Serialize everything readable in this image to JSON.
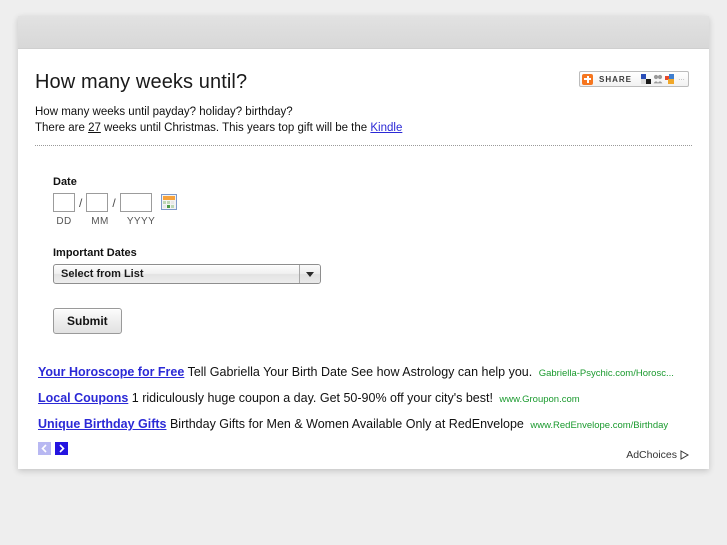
{
  "page": {
    "title": "How many weeks until?",
    "subtitle_line1": "How many weeks until payday? holiday? birthday?",
    "sentence_prefix": "There are ",
    "weeks_count": "27",
    "sentence_middle": " weeks until Christmas. This years top gift will be the ",
    "gift_link": "Kindle"
  },
  "share": {
    "label": "SHARE",
    "plus_icon": "addthis-plus-icon",
    "icon_1": "bookmark-icon",
    "icon_2": "facebook-icon",
    "icon_3": "more-services-icon",
    "dots": "…",
    "accent_color": "#f6761f"
  },
  "date_form": {
    "label": "Date",
    "day_value": "",
    "day_placeholder": "",
    "month_value": "",
    "month_placeholder": "",
    "year_value": "",
    "year_placeholder": "",
    "separator": "/",
    "hint_day": "DD",
    "hint_month": "MM",
    "hint_year": "YYYY",
    "calendar_icon": "calendar-picker-icon"
  },
  "important_dates": {
    "label": "Important Dates",
    "selected": "Select from List",
    "options": [
      "Select from List"
    ]
  },
  "submit": {
    "label": "Submit"
  },
  "ads": {
    "items": [
      {
        "title": "Your Horoscope for Free",
        "description": "Tell Gabriella Your Birth Date See how Astrology can help you.",
        "url": "Gabriella-Psychic.com/Horosc..."
      },
      {
        "title": "Local Coupons",
        "description": "1 ridiculously huge coupon a day. Get 50-90% off your city's best!",
        "url": "www.Groupon.com"
      },
      {
        "title": "Unique Birthday Gifts",
        "description": "Birthday Gifts for Men & Women Available Only at RedEnvelope",
        "url": "www.RedEnvelope.com/Birthday"
      }
    ],
    "prev_label": "‹",
    "next_label": "›",
    "adchoices_label": "AdChoices",
    "link_color": "#2b29d6",
    "url_color": "#1a9a2e"
  }
}
